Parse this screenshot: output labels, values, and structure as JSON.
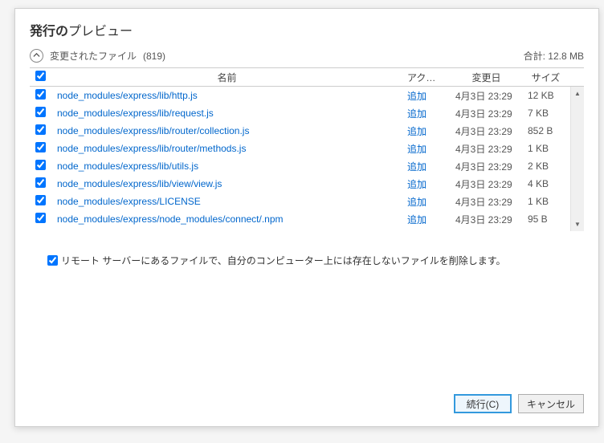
{
  "title_bold": "発行の",
  "title_rest": "プレビュー",
  "changed_files_label": "変更されたファイル",
  "changed_files_count": "(819)",
  "total_label": "合計:",
  "total_size": "12.8 MB",
  "columns": {
    "name": "名前",
    "action": "アクション",
    "date": "変更日",
    "size": "サイズ"
  },
  "rows": [
    {
      "name": "node_modules/express/lib/http.js",
      "action": "追加",
      "date": "4月3日 23:29",
      "size": "12 KB"
    },
    {
      "name": "node_modules/express/lib/request.js",
      "action": "追加",
      "date": "4月3日 23:29",
      "size": "7 KB"
    },
    {
      "name": "node_modules/express/lib/router/collection.js",
      "action": "追加",
      "date": "4月3日 23:29",
      "size": "852 B"
    },
    {
      "name": "node_modules/express/lib/router/methods.js",
      "action": "追加",
      "date": "4月3日 23:29",
      "size": "1 KB"
    },
    {
      "name": "node_modules/express/lib/utils.js",
      "action": "追加",
      "date": "4月3日 23:29",
      "size": "2 KB"
    },
    {
      "name": "node_modules/express/lib/view/view.js",
      "action": "追加",
      "date": "4月3日 23:29",
      "size": "4 KB"
    },
    {
      "name": "node_modules/express/LICENSE",
      "action": "追加",
      "date": "4月3日 23:29",
      "size": "1 KB"
    },
    {
      "name": "node_modules/express/node_modules/connect/.npm",
      "action": "追加",
      "date": "4月3日 23:29",
      "size": "95 B"
    }
  ],
  "delete_option": "リモート サーバーにあるファイルで、自分のコンピューター上には存在しないファイルを削除します。",
  "continue_label": "続行(C)",
  "cancel_label": "キャンセル"
}
